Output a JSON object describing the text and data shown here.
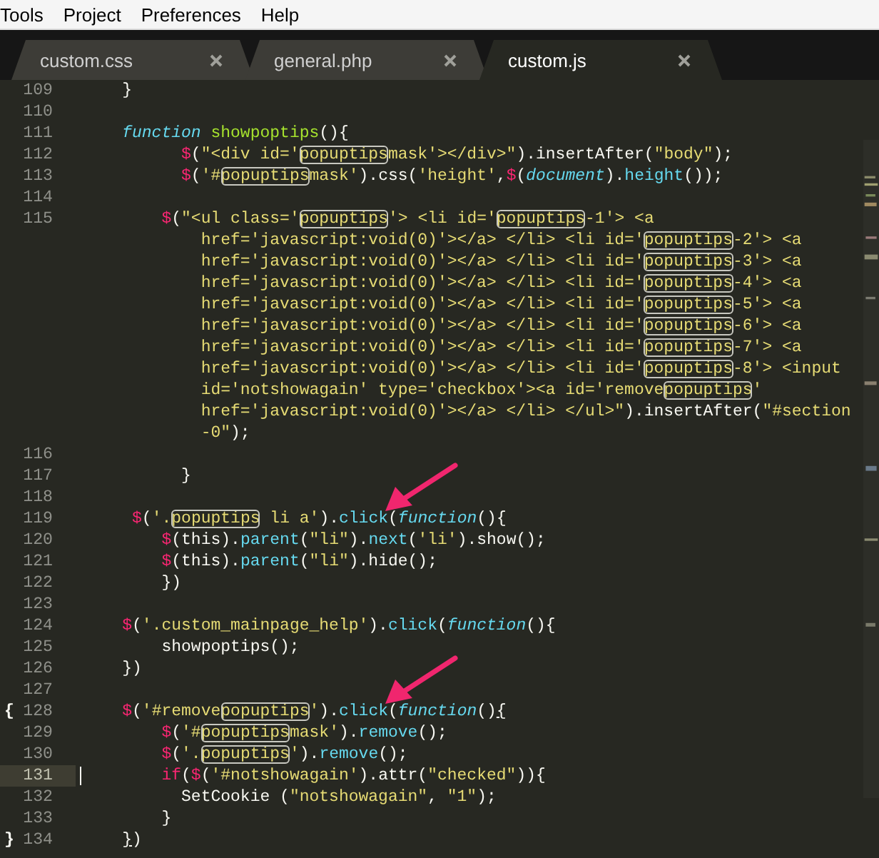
{
  "menu": [
    "Tools",
    "Project",
    "Preferences",
    "Help"
  ],
  "tabs": [
    {
      "label": "custom.css",
      "selected": false
    },
    {
      "label": "general.php",
      "selected": false
    },
    {
      "label": "custom.js",
      "selected": true
    }
  ],
  "lines": [
    {
      "number": "109",
      "rows": [
        {
          "tokens": [
            {
              "kind": "plain",
              "text": "    }"
            }
          ]
        }
      ]
    },
    {
      "number": "110"
    },
    {
      "number": "111",
      "rows": [
        {
          "tokens": [
            {
              "kind": "kw",
              "text": "    function"
            },
            {
              "kind": "name",
              "text": " showpoptips"
            },
            {
              "kind": "plain",
              "text": "(){"
            }
          ]
        }
      ]
    },
    {
      "number": "112",
      "rows": [
        {
          "tokens": [
            {
              "kind": "dollar",
              "text": "          $"
            },
            {
              "kind": "plain",
              "text": "("
            },
            {
              "kind": "str",
              "text": "\"<div id='"
            },
            {
              "kind": "match",
              "text": "popuptips"
            },
            {
              "kind": "str",
              "text": "mask'></div>\""
            },
            {
              "kind": "plain",
              "text": ").insertAfter("
            },
            {
              "kind": "str",
              "text": "\"body\""
            },
            {
              "kind": "plain",
              "text": ");"
            }
          ]
        }
      ]
    },
    {
      "number": "113",
      "rows": [
        {
          "tokens": [
            {
              "kind": "dollar",
              "text": "          $"
            },
            {
              "kind": "plain",
              "text": "("
            },
            {
              "kind": "str",
              "text": "'#"
            },
            {
              "kind": "match",
              "text": "popuptips"
            },
            {
              "kind": "str",
              "text": "mask'"
            },
            {
              "kind": "plain",
              "text": ").css("
            },
            {
              "kind": "str",
              "text": "'height'"
            },
            {
              "kind": "plain",
              "text": ","
            },
            {
              "kind": "dollar",
              "text": "$"
            },
            {
              "kind": "plain",
              "text": "("
            },
            {
              "kind": "kw",
              "text": "document"
            },
            {
              "kind": "plain",
              "text": ")."
            },
            {
              "kind": "fn",
              "text": "height"
            },
            {
              "kind": "plain",
              "text": "());"
            }
          ]
        }
      ]
    },
    {
      "number": "114"
    },
    {
      "number": "115",
      "rows": [
        {
          "tokens": [
            {
              "kind": "dollar",
              "text": "        $"
            },
            {
              "kind": "plain",
              "text": "("
            },
            {
              "kind": "str",
              "text": "\"<ul class='"
            },
            {
              "kind": "match",
              "text": "popuptips"
            },
            {
              "kind": "str",
              "text": "'> <li id='"
            },
            {
              "kind": "match",
              "text": "popuptips"
            },
            {
              "kind": "str",
              "text": "-1'> <a"
            }
          ]
        },
        {
          "tokens": [
            {
              "kind": "str",
              "text": "            href='javascript:void(0)'></a> </li> <li id='"
            },
            {
              "kind": "match",
              "text": "popuptips"
            },
            {
              "kind": "str",
              "text": "-2'> <a"
            }
          ]
        },
        {
          "tokens": [
            {
              "kind": "str",
              "text": "            href='javascript:void(0)'></a> </li> <li id='"
            },
            {
              "kind": "match",
              "text": "popuptips"
            },
            {
              "kind": "str",
              "text": "-3'> <a"
            }
          ]
        },
        {
          "tokens": [
            {
              "kind": "str",
              "text": "            href='javascript:void(0)'></a> </li> <li id='"
            },
            {
              "kind": "match",
              "text": "popuptips"
            },
            {
              "kind": "str",
              "text": "-4'> <a"
            }
          ]
        },
        {
          "tokens": [
            {
              "kind": "str",
              "text": "            href='javascript:void(0)'></a> </li> <li id='"
            },
            {
              "kind": "match",
              "text": "popuptips"
            },
            {
              "kind": "str",
              "text": "-5'> <a"
            }
          ]
        },
        {
          "tokens": [
            {
              "kind": "str",
              "text": "            href='javascript:void(0)'></a> </li> <li id='"
            },
            {
              "kind": "match",
              "text": "popuptips"
            },
            {
              "kind": "str",
              "text": "-6'> <a"
            }
          ]
        },
        {
          "tokens": [
            {
              "kind": "str",
              "text": "            href='javascript:void(0)'></a> </li> <li id='"
            },
            {
              "kind": "match",
              "text": "popuptips"
            },
            {
              "kind": "str",
              "text": "-7'> <a"
            }
          ]
        },
        {
          "tokens": [
            {
              "kind": "str",
              "text": "            href='javascript:void(0)'></a> </li> <li id='"
            },
            {
              "kind": "match",
              "text": "popuptips"
            },
            {
              "kind": "str",
              "text": "-8'> <input"
            }
          ]
        },
        {
          "tokens": [
            {
              "kind": "str",
              "text": "            id='notshowagain' type='checkbox'><a id='remove"
            },
            {
              "kind": "match",
              "text": "popuptips"
            },
            {
              "kind": "str",
              "text": "'"
            }
          ]
        },
        {
          "tokens": [
            {
              "kind": "str",
              "text": "            href='javascript:void(0)'></a> </li> </ul>\""
            },
            {
              "kind": "plain",
              "text": ").insertAfter("
            },
            {
              "kind": "str",
              "text": "\"#section"
            }
          ]
        },
        {
          "tokens": [
            {
              "kind": "str",
              "text": "            -0\""
            },
            {
              "kind": "plain",
              "text": ");"
            }
          ]
        }
      ]
    },
    {
      "number": "116"
    },
    {
      "number": "117",
      "rows": [
        {
          "tokens": [
            {
              "kind": "plain",
              "text": "          }"
            }
          ]
        }
      ]
    },
    {
      "number": "118"
    },
    {
      "number": "119",
      "arrow": true,
      "rows": [
        {
          "tokens": [
            {
              "kind": "dollar",
              "text": "     $"
            },
            {
              "kind": "plain",
              "text": "("
            },
            {
              "kind": "str",
              "text": "'."
            },
            {
              "kind": "match",
              "text": "popuptips"
            },
            {
              "kind": "str",
              "text": " li a'"
            },
            {
              "kind": "plain",
              "text": ")."
            },
            {
              "kind": "fn",
              "text": "click"
            },
            {
              "kind": "plain",
              "text": "("
            },
            {
              "kind": "kw",
              "text": "function"
            },
            {
              "kind": "plain",
              "text": "(){"
            }
          ]
        }
      ]
    },
    {
      "number": "120",
      "rows": [
        {
          "tokens": [
            {
              "kind": "dollar",
              "text": "        $"
            },
            {
              "kind": "plain",
              "text": "(this)."
            },
            {
              "kind": "fn",
              "text": "parent"
            },
            {
              "kind": "plain",
              "text": "("
            },
            {
              "kind": "str",
              "text": "\"li\""
            },
            {
              "kind": "plain",
              "text": ")."
            },
            {
              "kind": "fn",
              "text": "next"
            },
            {
              "kind": "plain",
              "text": "("
            },
            {
              "kind": "str",
              "text": "'li'"
            },
            {
              "kind": "plain",
              "text": ").show();"
            }
          ]
        }
      ]
    },
    {
      "number": "121",
      "rows": [
        {
          "tokens": [
            {
              "kind": "dollar",
              "text": "        $"
            },
            {
              "kind": "plain",
              "text": "(this)."
            },
            {
              "kind": "fn",
              "text": "parent"
            },
            {
              "kind": "plain",
              "text": "("
            },
            {
              "kind": "str",
              "text": "\"li\""
            },
            {
              "kind": "plain",
              "text": ").hide();"
            }
          ]
        }
      ]
    },
    {
      "number": "122",
      "rows": [
        {
          "tokens": [
            {
              "kind": "plain",
              "text": "        })"
            }
          ]
        }
      ]
    },
    {
      "number": "123"
    },
    {
      "number": "124",
      "rows": [
        {
          "tokens": [
            {
              "kind": "dollar",
              "text": "    $"
            },
            {
              "kind": "plain",
              "text": "("
            },
            {
              "kind": "str",
              "text": "'.custom_mainpage_help'"
            },
            {
              "kind": "plain",
              "text": ")."
            },
            {
              "kind": "fn",
              "text": "click"
            },
            {
              "kind": "plain",
              "text": "("
            },
            {
              "kind": "kw",
              "text": "function"
            },
            {
              "kind": "plain",
              "text": "(){"
            }
          ]
        }
      ]
    },
    {
      "number": "125",
      "rows": [
        {
          "tokens": [
            {
              "kind": "plain",
              "text": "        showpoptips();"
            }
          ]
        }
      ]
    },
    {
      "number": "126",
      "rows": [
        {
          "tokens": [
            {
              "kind": "plain",
              "text": "    })"
            }
          ]
        }
      ]
    },
    {
      "number": "127"
    },
    {
      "number": "128",
      "fold": "{",
      "arrow": true,
      "rows": [
        {
          "tokens": [
            {
              "kind": "dollar",
              "text": "    $"
            },
            {
              "kind": "plain",
              "text": "("
            },
            {
              "kind": "str",
              "text": "'#remove"
            },
            {
              "kind": "match",
              "text": "popuptips"
            },
            {
              "kind": "str",
              "text": "'"
            },
            {
              "kind": "plain",
              "text": ")."
            },
            {
              "kind": "fn",
              "text": "click"
            },
            {
              "kind": "plain",
              "text": "("
            },
            {
              "kind": "kw",
              "text": "function"
            },
            {
              "kind": "plain",
              "text": "()"
            },
            {
              "kind": "bracket",
              "text": "{"
            }
          ]
        }
      ]
    },
    {
      "number": "129",
      "rows": [
        {
          "tokens": [
            {
              "kind": "dollar",
              "text": "        $"
            },
            {
              "kind": "plain",
              "text": "("
            },
            {
              "kind": "str",
              "text": "'#"
            },
            {
              "kind": "match",
              "text": "popuptips"
            },
            {
              "kind": "str",
              "text": "mask'"
            },
            {
              "kind": "plain",
              "text": ")."
            },
            {
              "kind": "fn",
              "text": "remove"
            },
            {
              "kind": "plain",
              "text": "();"
            }
          ]
        }
      ]
    },
    {
      "number": "130",
      "rows": [
        {
          "tokens": [
            {
              "kind": "dollar",
              "text": "        $"
            },
            {
              "kind": "plain",
              "text": "("
            },
            {
              "kind": "str",
              "text": "'."
            },
            {
              "kind": "match",
              "text": "popuptips"
            },
            {
              "kind": "str",
              "text": "'"
            },
            {
              "kind": "plain",
              "text": ")."
            },
            {
              "kind": "fn",
              "text": "remove"
            },
            {
              "kind": "plain",
              "text": "();"
            }
          ]
        }
      ]
    },
    {
      "number": "131",
      "current": true,
      "rows": [
        {
          "tokens": [
            {
              "kind": "dollar",
              "text": "        if"
            },
            {
              "kind": "plain",
              "text": "("
            },
            {
              "kind": "dollar",
              "text": "$"
            },
            {
              "kind": "plain",
              "text": "("
            },
            {
              "kind": "str",
              "text": "'#notshowagain'"
            },
            {
              "kind": "plain",
              "text": ").attr("
            },
            {
              "kind": "str",
              "text": "\"checked\""
            },
            {
              "kind": "plain",
              "text": ")){"
            }
          ]
        }
      ]
    },
    {
      "number": "132",
      "rows": [
        {
          "tokens": [
            {
              "kind": "plain",
              "text": "          SetCookie ("
            },
            {
              "kind": "str",
              "text": "\"notshowagain\""
            },
            {
              "kind": "plain",
              "text": ", "
            },
            {
              "kind": "str",
              "text": "\"1\""
            },
            {
              "kind": "plain",
              "text": ");"
            }
          ]
        }
      ]
    },
    {
      "number": "133",
      "rows": [
        {
          "tokens": [
            {
              "kind": "plain",
              "text": "        }"
            }
          ]
        }
      ]
    },
    {
      "number": "134",
      "fold": "}",
      "rows": [
        {
          "tokens": [
            {
              "kind": "bracket",
              "text": "    }"
            },
            {
              "kind": "plain",
              "text": ")"
            }
          ]
        }
      ]
    }
  ]
}
